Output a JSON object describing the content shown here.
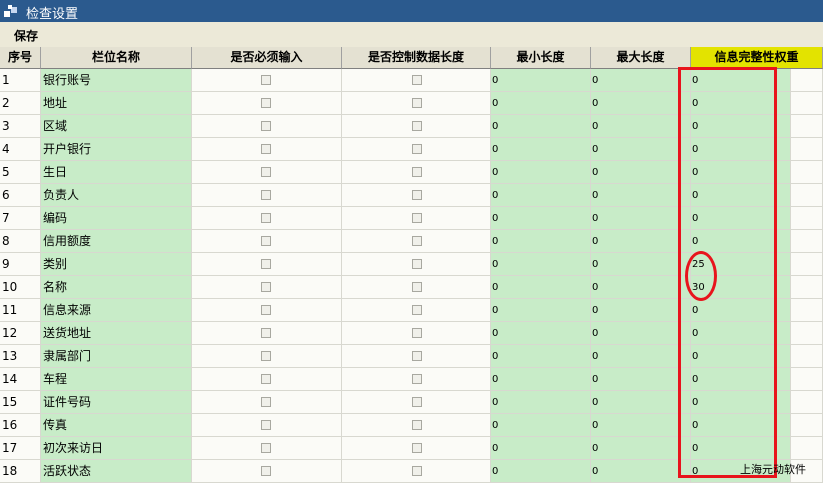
{
  "window": {
    "title": "检查设置"
  },
  "toolbar": {
    "save_label": "保存"
  },
  "columns": [
    "序号",
    "栏位名称",
    "是否必须输入",
    "是否控制数据长度",
    "最小长度",
    "最大长度",
    "信息完整性权重"
  ],
  "rows": [
    {
      "no": "1",
      "name": "银行账号",
      "required": false,
      "control_length": false,
      "min": "0",
      "max": "0",
      "weight": "0"
    },
    {
      "no": "2",
      "name": "地址",
      "required": false,
      "control_length": false,
      "min": "0",
      "max": "0",
      "weight": "0"
    },
    {
      "no": "3",
      "name": "区域",
      "required": false,
      "control_length": false,
      "min": "0",
      "max": "0",
      "weight": "0"
    },
    {
      "no": "4",
      "name": "开户银行",
      "required": false,
      "control_length": false,
      "min": "0",
      "max": "0",
      "weight": "0"
    },
    {
      "no": "5",
      "name": "生日",
      "required": false,
      "control_length": false,
      "min": "0",
      "max": "0",
      "weight": "0"
    },
    {
      "no": "6",
      "name": "负责人",
      "required": false,
      "control_length": false,
      "min": "0",
      "max": "0",
      "weight": "0"
    },
    {
      "no": "7",
      "name": "编码",
      "required": false,
      "control_length": false,
      "min": "0",
      "max": "0",
      "weight": "0"
    },
    {
      "no": "8",
      "name": "信用额度",
      "required": false,
      "control_length": false,
      "min": "0",
      "max": "0",
      "weight": "0"
    },
    {
      "no": "9",
      "name": "类别",
      "required": false,
      "control_length": false,
      "min": "0",
      "max": "0",
      "weight": "25"
    },
    {
      "no": "10",
      "name": "名称",
      "required": false,
      "control_length": false,
      "min": "0",
      "max": "0",
      "weight": "30"
    },
    {
      "no": "11",
      "name": "信息来源",
      "required": false,
      "control_length": false,
      "min": "0",
      "max": "0",
      "weight": "0"
    },
    {
      "no": "12",
      "name": "送货地址",
      "required": false,
      "control_length": false,
      "min": "0",
      "max": "0",
      "weight": "0"
    },
    {
      "no": "13",
      "name": "隶属部门",
      "required": false,
      "control_length": false,
      "min": "0",
      "max": "0",
      "weight": "0"
    },
    {
      "no": "14",
      "name": "车程",
      "required": false,
      "control_length": false,
      "min": "0",
      "max": "0",
      "weight": "0"
    },
    {
      "no": "15",
      "name": "证件号码",
      "required": false,
      "control_length": false,
      "min": "0",
      "max": "0",
      "weight": "0"
    },
    {
      "no": "16",
      "name": "传真",
      "required": false,
      "control_length": false,
      "min": "0",
      "max": "0",
      "weight": "0"
    },
    {
      "no": "17",
      "name": "初次来访日",
      "required": false,
      "control_length": false,
      "min": "0",
      "max": "0",
      "weight": "0"
    },
    {
      "no": "18",
      "name": "活跃状态",
      "required": false,
      "control_length": false,
      "min": "0",
      "max": "0",
      "weight": "0"
    }
  ],
  "watermark": "上海元动软件",
  "colors": {
    "titlebar": "#2b5a8e",
    "editable_cell": "#c8ecc8",
    "highlight_header": "#e3e300",
    "annotation": "#e8141c"
  }
}
